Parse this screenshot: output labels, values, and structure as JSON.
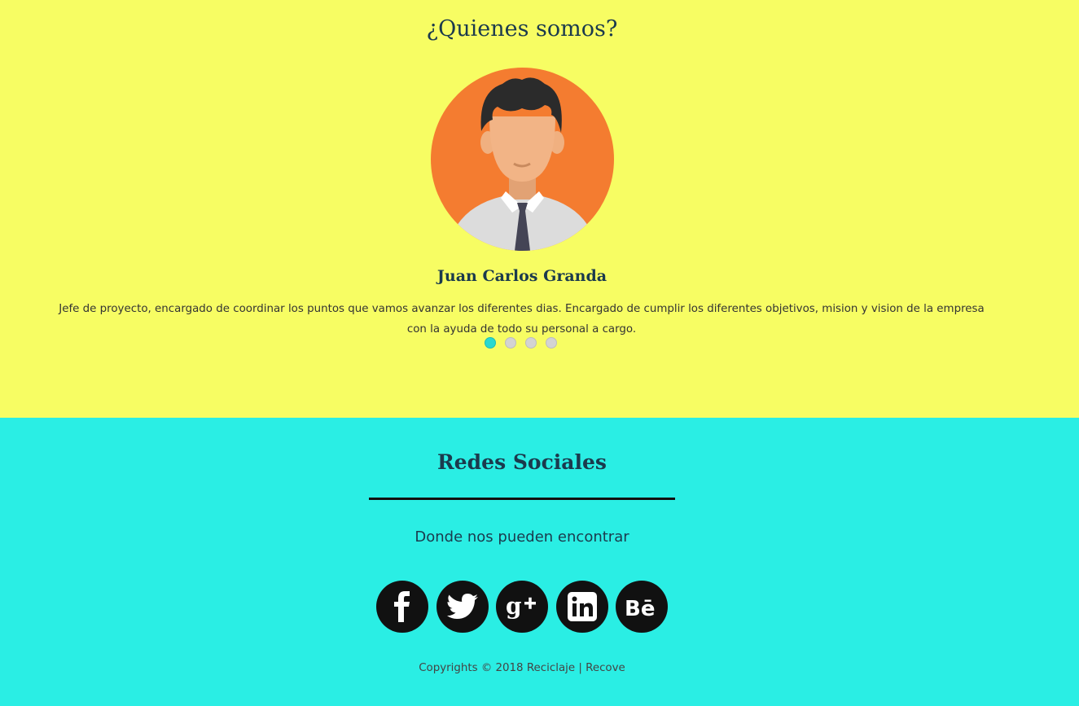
{
  "team": {
    "title": "¿Quienes somos?",
    "member": {
      "name": "Juan Carlos Granda",
      "description": "Jefe de proyecto, encargado de coordinar los puntos que vamos avanzar los diferentes dias. Encargado de cumplir los diferentes objetivos, mision y vision de la empresa con la ayuda de todo su personal a cargo."
    },
    "carousel": {
      "slides": 4,
      "active_index": 0
    }
  },
  "social": {
    "title": "Redes Sociales",
    "subtitle": "Donde nos pueden encontrar",
    "icons": [
      "facebook-icon",
      "twitter-icon",
      "google-plus-icon",
      "linkedin-icon",
      "behance-icon"
    ]
  },
  "footer": {
    "copyright": "Copyrights © 2018 Reciclaje | Recove"
  },
  "colors": {
    "team_bg": "#f7fd63",
    "social_bg": "#2aeee4",
    "avatar_bg": "#f47c30",
    "dot_active": "#29d9d0",
    "icon_bg": "#111111"
  }
}
